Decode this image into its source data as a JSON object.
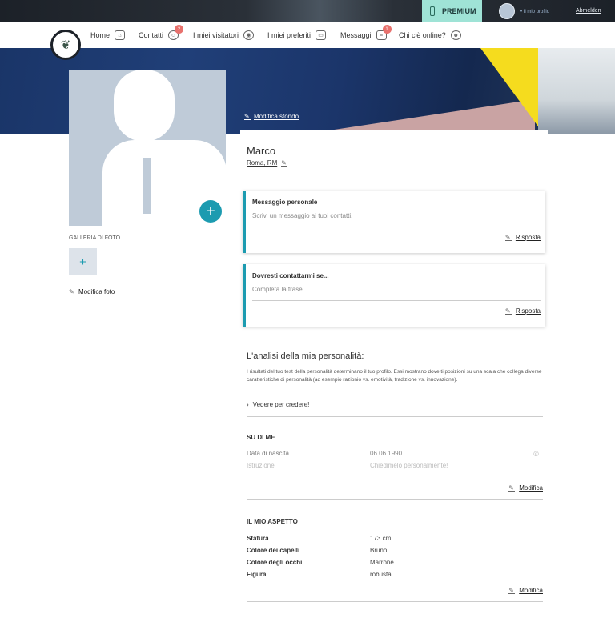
{
  "topbar": {
    "premium_label": "PREMIUM",
    "account_label": "Il mio profilo",
    "logout_label": "Abmelden"
  },
  "nav": {
    "items": [
      {
        "label": "Home",
        "icon": "home-icon"
      },
      {
        "label": "Contatti",
        "icon": "user-icon",
        "badge": "2"
      },
      {
        "label": "I miei visitatori",
        "icon": "eye-icon"
      },
      {
        "label": "I miei preferiti",
        "icon": "bookmark-icon"
      },
      {
        "label": "Messaggi",
        "icon": "chat-icon",
        "badge": "1"
      },
      {
        "label": "Chi c'è online?",
        "icon": "online-icon"
      }
    ]
  },
  "banner": {
    "edit_label": "Modifica sfondo"
  },
  "profile": {
    "name": "Marco",
    "city": "Roma, RM",
    "gallery_title": "GALLERIA DI FOTO",
    "edit_photo_label": "Modifica foto"
  },
  "messages": [
    {
      "title": "Messaggio personale",
      "placeholder": "Scrivi un messaggio ai tuoi contatti.",
      "action": "Risposta"
    },
    {
      "title": "Dovresti contattarmi se...",
      "placeholder": "Completa la frase",
      "action": "Risposta"
    }
  ],
  "personality": {
    "title": "L'analisi della mia personalità:",
    "text": "I risultati del tuo test della personalità determinano il tuo profilo. Essi mostrano dove ti posizioni su una scala che collega diverse caratteristiche di personalità (ad esempio razionio vs. emotività, tradizione vs. innovazione).",
    "link": "Vedere per credere!"
  },
  "about": {
    "title": "SU DI ME",
    "rows": [
      {
        "key": "Data di nascita",
        "value": "06.06.1990"
      },
      {
        "key": "Istruzione",
        "value": "Chiedimelo personalmente!"
      }
    ],
    "edit": "Modifica"
  },
  "look": {
    "title": "IL MIO ASPETTO",
    "rows": [
      {
        "key": "Statura",
        "value": "173 cm"
      },
      {
        "key": "Colore dei capelli",
        "value": "Bruno"
      },
      {
        "key": "Colore degli occhi",
        "value": "Marrone"
      },
      {
        "key": "Figura",
        "value": "robusta"
      }
    ],
    "edit": "Modifica"
  },
  "colors": {
    "accent": "#1c9bb0",
    "badge": "#e8716d",
    "premium": "#9fe3d6"
  }
}
